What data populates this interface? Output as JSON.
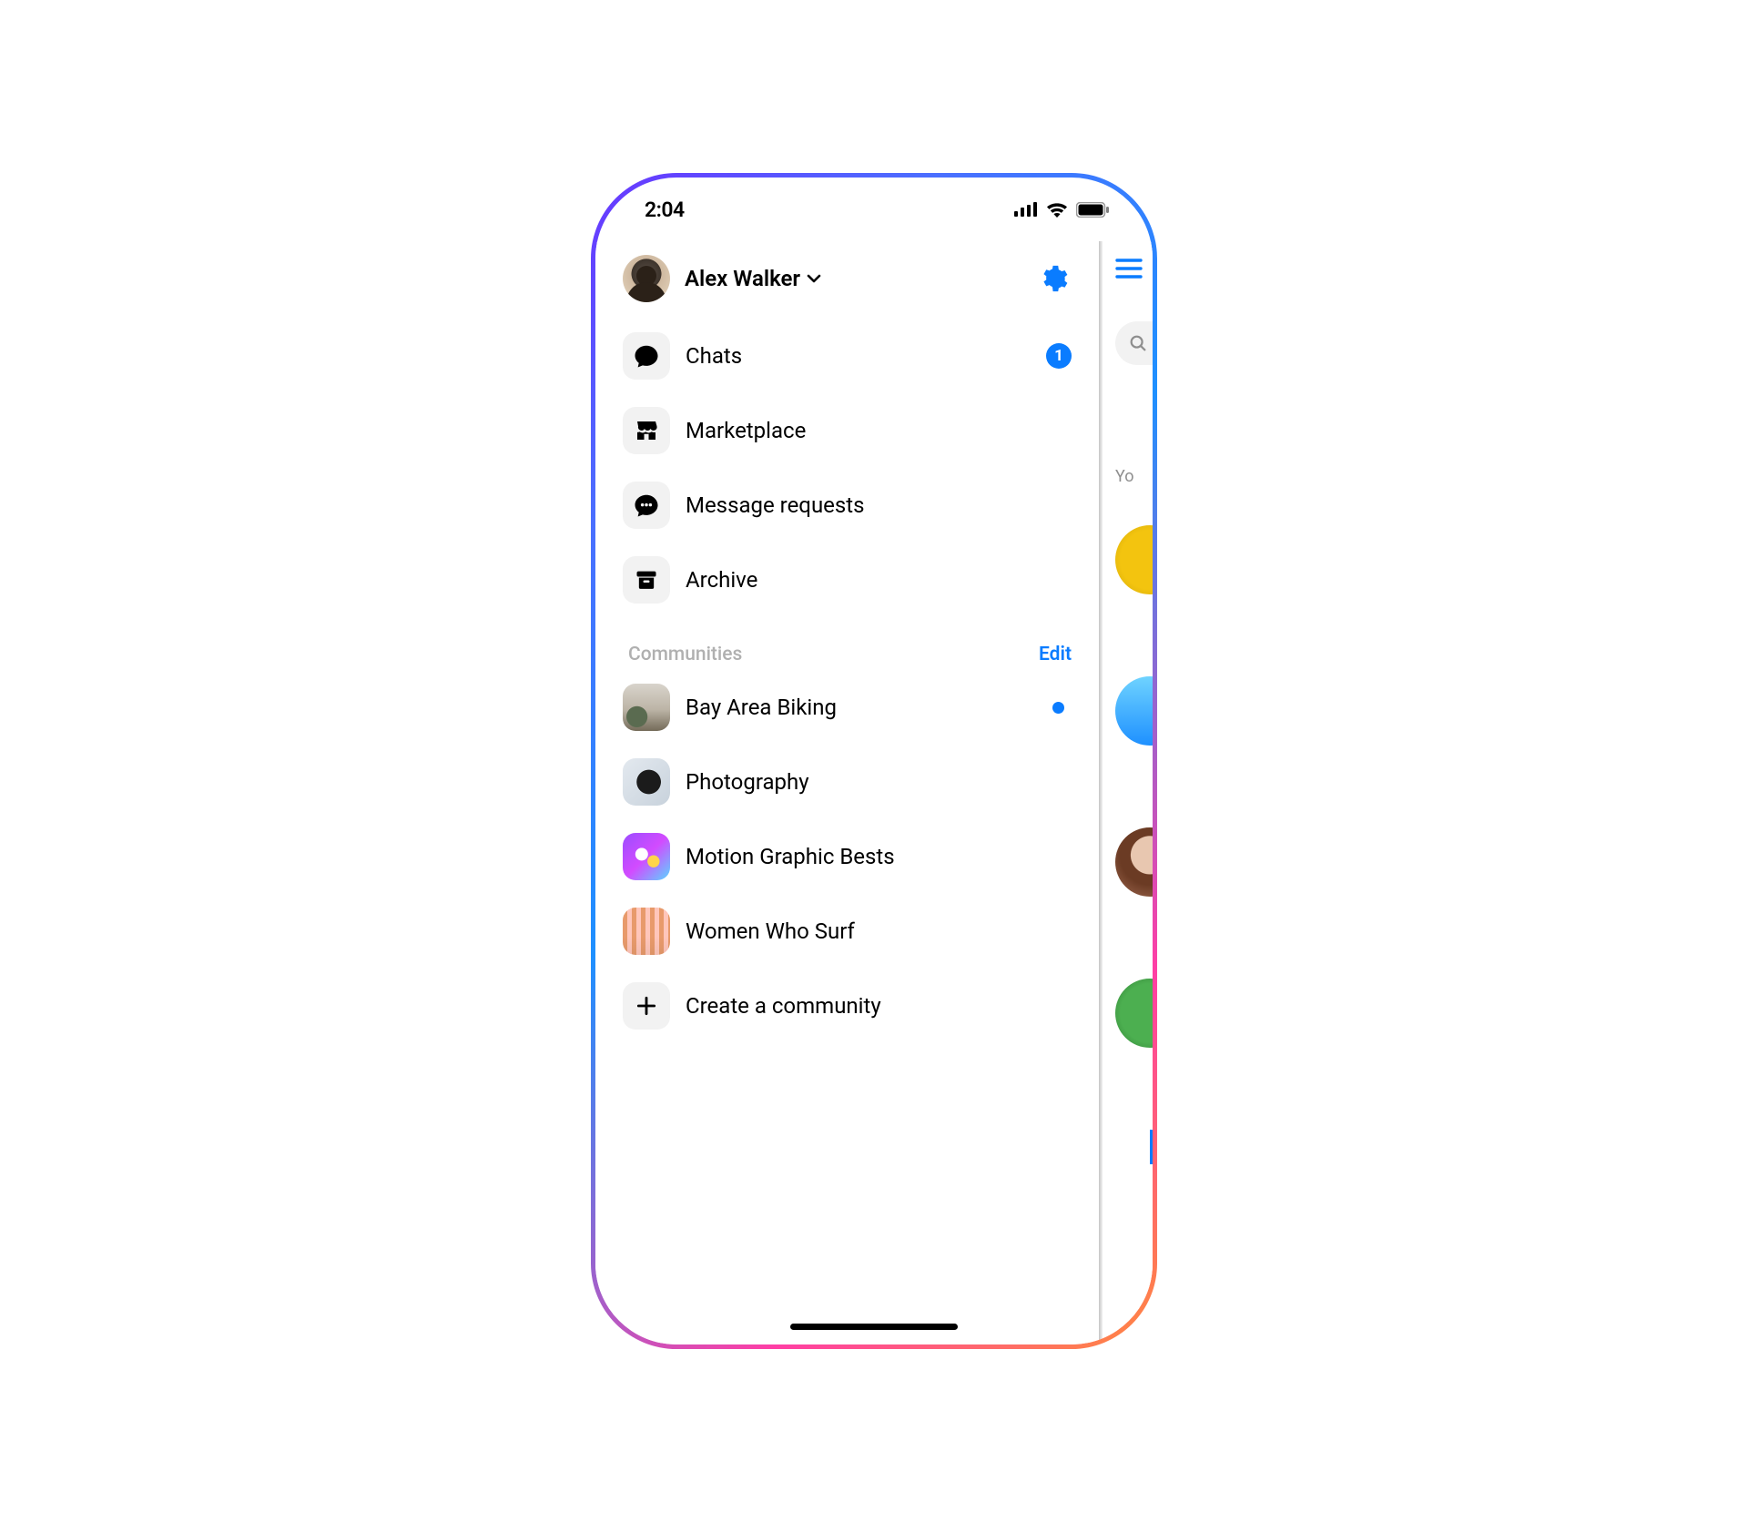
{
  "status": {
    "time": "2:04"
  },
  "profile": {
    "name": "Alex Walker"
  },
  "menu": {
    "chats": {
      "label": "Chats",
      "badge": "1"
    },
    "marketplace": {
      "label": "Marketplace"
    },
    "message_requests": {
      "label": "Message requests"
    },
    "archive": {
      "label": "Archive"
    }
  },
  "communities": {
    "title": "Communities",
    "edit": "Edit",
    "items": [
      {
        "label": "Bay Area Biking",
        "unread": true
      },
      {
        "label": "Photography",
        "unread": false
      },
      {
        "label": "Motion Graphic Bests",
        "unread": false
      },
      {
        "label": "Women Who Surf",
        "unread": false
      }
    ],
    "create": "Create a community"
  },
  "peek": {
    "story_label": "Yo"
  },
  "colors": {
    "accent": "#0a7cff"
  }
}
